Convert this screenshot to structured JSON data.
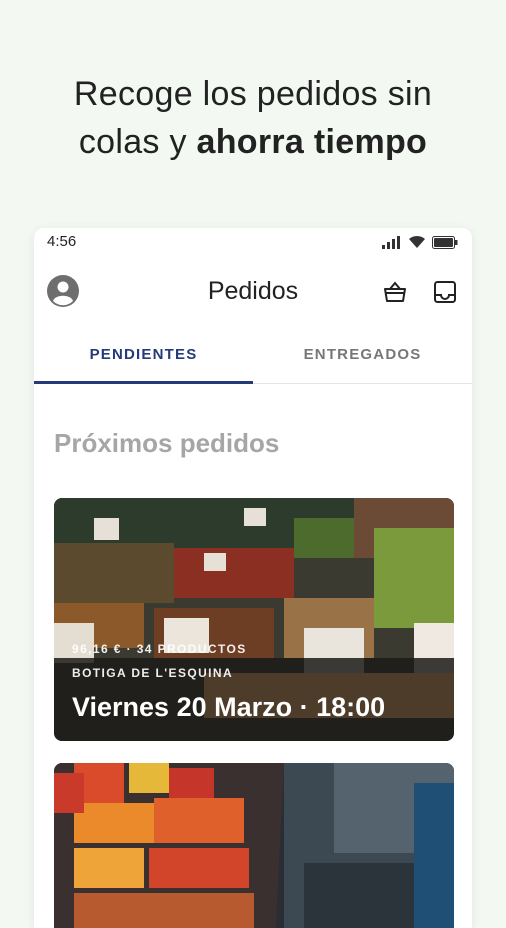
{
  "headline": {
    "line1": "Recoge los pedidos sin",
    "line2_regular": "colas y ",
    "line2_bold": "ahorra tiempo"
  },
  "statusbar": {
    "time": "4:56"
  },
  "appbar": {
    "title": "Pedidos"
  },
  "tabs": [
    {
      "label": "PENDIENTES",
      "active": true
    },
    {
      "label": "ENTREGADOS",
      "active": false
    }
  ],
  "section": {
    "title": "Próximos pedidos"
  },
  "orders": [
    {
      "meta": "96,16 € · 34 PRODUCTOS",
      "store": "BOTIGA DE L'ESQUINA",
      "datetime": "Viernes 20 Marzo · 18:00"
    }
  ],
  "colors": {
    "accent": "#253a78",
    "background": "#f3f8f3"
  },
  "icons": [
    "avatar-icon",
    "basket-icon",
    "inbox-icon",
    "signal-icon",
    "wifi-icon",
    "battery-icon"
  ]
}
